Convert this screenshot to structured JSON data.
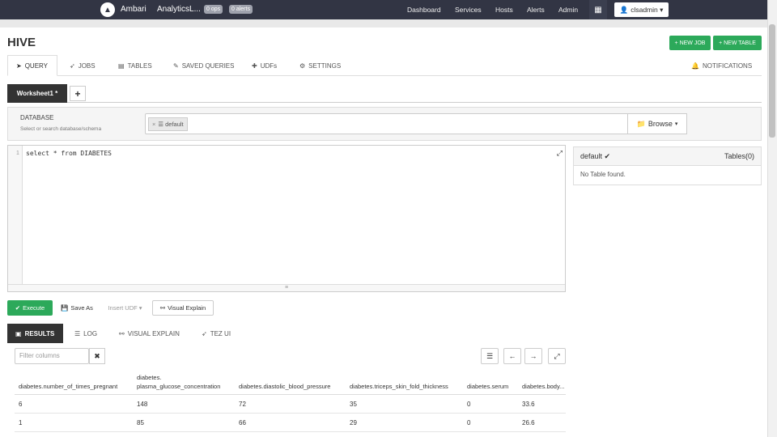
{
  "topbar": {
    "brand": "Ambari",
    "cluster": "AnalyticsL...",
    "badges": [
      "0 ops",
      "0 alerts"
    ],
    "nav": [
      "Dashboard",
      "Services",
      "Hosts",
      "Alerts",
      "Admin"
    ],
    "user": "clsadmin ▾"
  },
  "header": {
    "title": "HIVE",
    "new_job": "+ NEW JOB",
    "new_table": "+ NEW TABLE"
  },
  "tabs": {
    "query": "QUERY",
    "jobs": "JOBS",
    "tables": "TABLES",
    "saved": "SAVED QUERIES",
    "udfs": "UDFs",
    "settings": "SETTINGS",
    "notifications": "NOTIFICATIONS"
  },
  "worksheet": {
    "name": "Worksheet1 *",
    "add": "+"
  },
  "database": {
    "label": "DATABASE",
    "sublabel": "Select or search database/schema",
    "selected": "default",
    "browse": "Browse"
  },
  "editor": {
    "line": "1",
    "code": "select * from DIABETES"
  },
  "tables_panel": {
    "db": "default ✔",
    "count": "Tables(0)",
    "empty": "No Table found."
  },
  "actions": {
    "execute": "Execute",
    "save_as": "Save As",
    "insert_udf": "Insert UDF ▾",
    "visual_explain": "Visual Explain"
  },
  "result_tabs": {
    "results": "RESULTS",
    "log": "LOG",
    "visual": "VISUAL EXPLAIN",
    "tez": "TEZ UI"
  },
  "filter": {
    "placeholder": "Filter columns"
  },
  "results": {
    "columns": [
      "diabetes.number_of_times_pregnant",
      "diabetes.\nplasma_glucose_concentration",
      "diabetes.diastolic_blood_pressure",
      "diabetes.triceps_skin_fold_thickness",
      "diabetes.serum",
      "diabetes.body..."
    ],
    "rows": [
      [
        "6",
        "148",
        "72",
        "35",
        "0",
        "33.6"
      ],
      [
        "1",
        "85",
        "66",
        "29",
        "0",
        "26.6"
      ]
    ]
  }
}
